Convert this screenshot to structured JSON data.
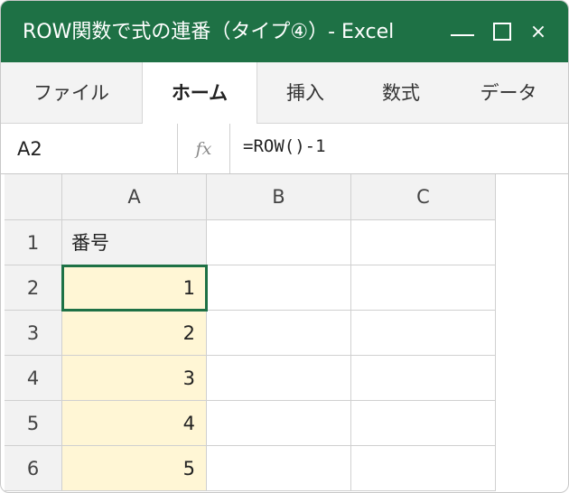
{
  "window": {
    "title": "ROW関数で式の連番（タイプ④）- Excel",
    "controls": {
      "minimize": "—",
      "maximize": "☐",
      "close": "×"
    },
    "accent": "#1e7145"
  },
  "ribbon": {
    "tabs": [
      {
        "label": "ファイル",
        "active": false
      },
      {
        "label": "ホーム",
        "active": true
      },
      {
        "label": "挿入",
        "active": false
      },
      {
        "label": "数式",
        "active": false
      },
      {
        "label": "データ",
        "active": false
      }
    ]
  },
  "formula_bar": {
    "name_box": "A2",
    "fx_label": "fx",
    "formula": "=ROW()-1"
  },
  "sheet": {
    "columns": [
      "A",
      "B",
      "C"
    ],
    "rows": [
      {
        "num": "1",
        "cells": [
          "番号",
          "",
          ""
        ]
      },
      {
        "num": "2",
        "cells": [
          "1",
          "",
          ""
        ]
      },
      {
        "num": "3",
        "cells": [
          "2",
          "",
          ""
        ]
      },
      {
        "num": "4",
        "cells": [
          "3",
          "",
          ""
        ]
      },
      {
        "num": "5",
        "cells": [
          "4",
          "",
          ""
        ]
      },
      {
        "num": "6",
        "cells": [
          "5",
          "",
          ""
        ]
      }
    ],
    "selected_cell": "A2",
    "highlight_color": "#fff6d5"
  }
}
